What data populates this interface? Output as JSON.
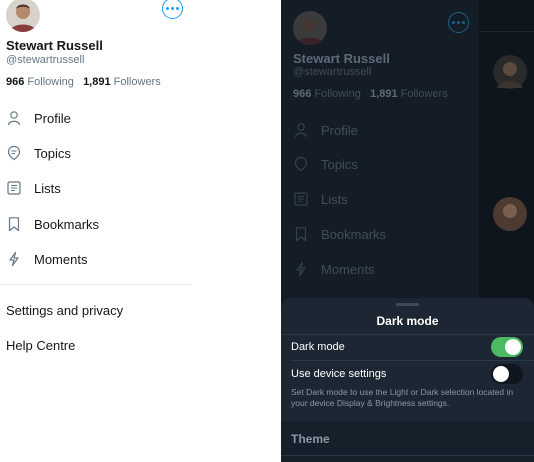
{
  "profile": {
    "name": "Stewart Russell",
    "handle": "@stewartrussell",
    "following_count": "966",
    "following_label": "Following",
    "followers_count": "1,891",
    "followers_label": "Followers"
  },
  "menu": {
    "items": [
      {
        "label": "Profile",
        "icon": "person-icon"
      },
      {
        "label": "Topics",
        "icon": "topic-icon"
      },
      {
        "label": "Lists",
        "icon": "list-icon"
      },
      {
        "label": "Bookmarks",
        "icon": "bookmark-icon"
      },
      {
        "label": "Moments",
        "icon": "lightning-icon"
      }
    ],
    "settings": "Settings and privacy",
    "help": "Help Centre"
  },
  "dark_sheet": {
    "title": "Dark mode",
    "dark_mode_label": "Dark mode",
    "dark_mode_on": true,
    "device_settings_label": "Use device settings",
    "device_settings_on": false,
    "help_text": "Set Dark mode to use the Light or Dark selection located in your device Display & Brightness settings.",
    "theme_heading": "Theme"
  },
  "colors": {
    "accent": "#1da1f2",
    "toggle_on": "#4cb963",
    "light_bg": "#ffffff",
    "dark_bg": "#141d26",
    "sheet_bg": "#1c2733"
  }
}
